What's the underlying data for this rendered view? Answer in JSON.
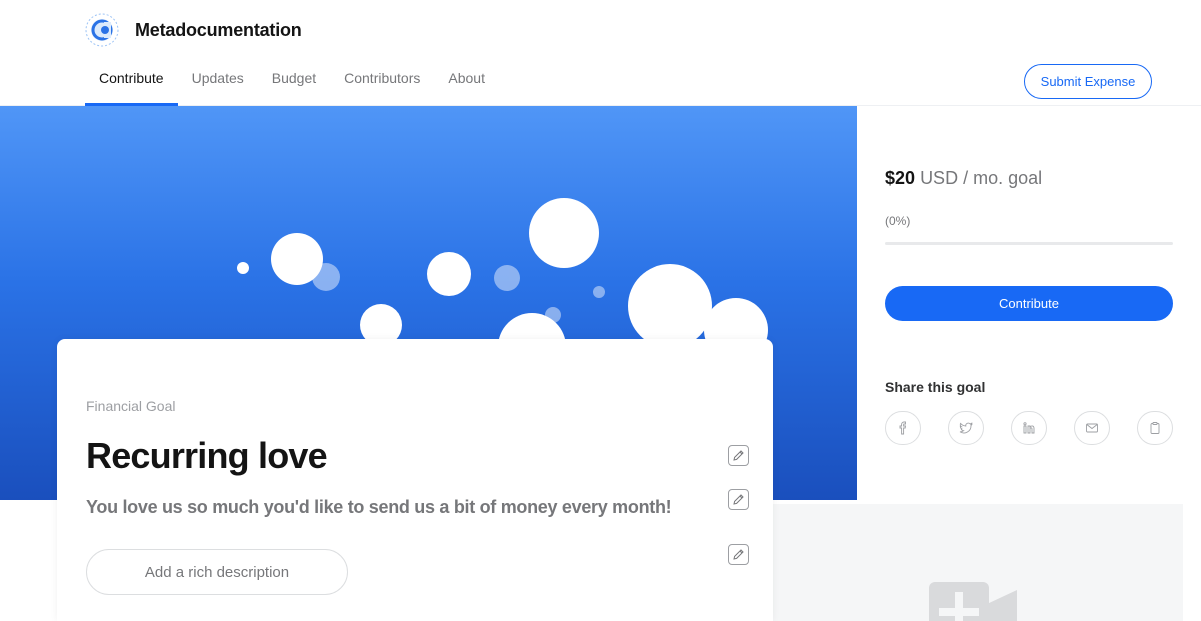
{
  "org": {
    "name": "Metadocumentation"
  },
  "nav": {
    "items": [
      {
        "label": "Contribute",
        "active": true
      },
      {
        "label": "Updates"
      },
      {
        "label": "Budget"
      },
      {
        "label": "Contributors"
      },
      {
        "label": "About"
      }
    ],
    "submit_expense": "Submit Expense"
  },
  "goal": {
    "amount": "$20",
    "unit": "USD / mo. goal",
    "percent": "(0%)",
    "progress_fraction": 0,
    "contribute_label": "Contribute",
    "share_title": "Share this goal",
    "share_icons": [
      "facebook-icon",
      "twitter-icon",
      "linkedin-icon",
      "mail-icon",
      "clipboard-icon"
    ]
  },
  "card": {
    "label": "Financial Goal",
    "title": "Recurring love",
    "description": "You love us so much you'd like to send us a bit of money every month!",
    "rich_description_button": "Add a rich description"
  },
  "colors": {
    "accent": "#1869f5",
    "hero_top": "#5096f7",
    "hero_bottom": "#1a4fbd"
  }
}
